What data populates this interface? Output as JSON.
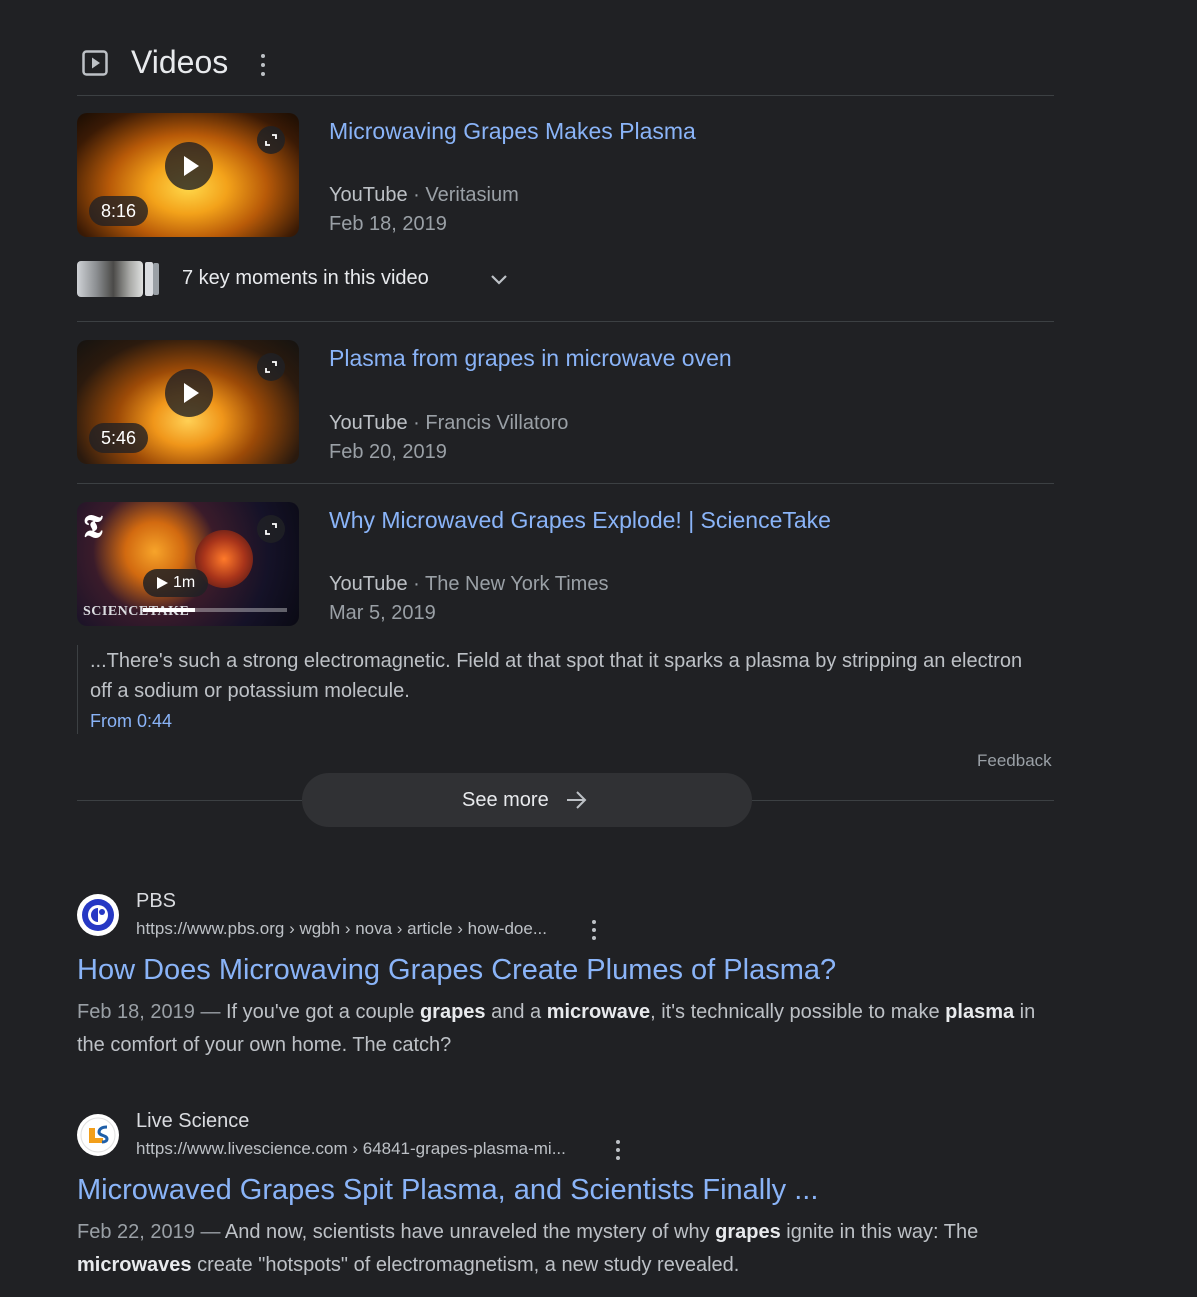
{
  "videos_section": {
    "title": "Videos",
    "icons": {
      "section": "video-box-icon",
      "more": "more-vert-icon",
      "expand": "expand-icon"
    },
    "items": [
      {
        "title": "Microwaving Grapes Makes Plasma",
        "source": "YouTube",
        "channel": "Veritasium",
        "date": "Feb 18, 2019",
        "duration": "8:16",
        "key_moments": "7 key moments in this video"
      },
      {
        "title": "Plasma from grapes in microwave oven",
        "source": "YouTube",
        "channel": "Francis Villatoro",
        "date": "Feb 20, 2019",
        "duration": "5:46"
      },
      {
        "title": "Why Microwaved Grapes Explode! | ScienceTake",
        "source": "YouTube",
        "channel": "The New York Times",
        "date": "Mar 5, 2019",
        "duration": "1m",
        "thumb_caption": "SCIENCETAKE",
        "preview_progress": 0.36,
        "snippet": "...There's such a strong electromagnetic. Field at that spot that it sparks a plasma by stripping an electron off a sodium or potassium molecule.",
        "snippet_link": "From 0:44"
      }
    ],
    "separator": "·",
    "feedback": "Feedback",
    "see_more": "See more"
  },
  "results": [
    {
      "site": "PBS",
      "url": "https://www.pbs.org › wgbh › nova › article › how-doe...",
      "title": "How Does Microwaving Grapes Create Plumes of Plasma?",
      "date": "Feb 18, 2019",
      "snippet_parts": [
        "If you've got a couple ",
        "grapes",
        " and a ",
        "microwave",
        ", it's technically possible to make ",
        "plasma",
        " in the comfort of your own home. The catch?"
      ],
      "logo_color": "#2638c4"
    },
    {
      "site": "Live Science",
      "url": "https://www.livescience.com › 64841-grapes-plasma-mi...",
      "title": "Microwaved Grapes Spit Plasma, and Scientists Finally ...",
      "date": "Feb 22, 2019",
      "snippet_parts": [
        "And now, scientists have unraveled the mystery of why ",
        "grapes",
        " ignite in this way: The ",
        "microwaves",
        " create \"hotspots\" of electromagnetism, a new study revealed."
      ],
      "logo_color": "#f29f1b"
    }
  ],
  "dash": "—",
  "colors": {
    "background": "#202124",
    "link": "#8ab4f8",
    "text": "#bdc1c6",
    "muted": "#9aa0a6"
  }
}
